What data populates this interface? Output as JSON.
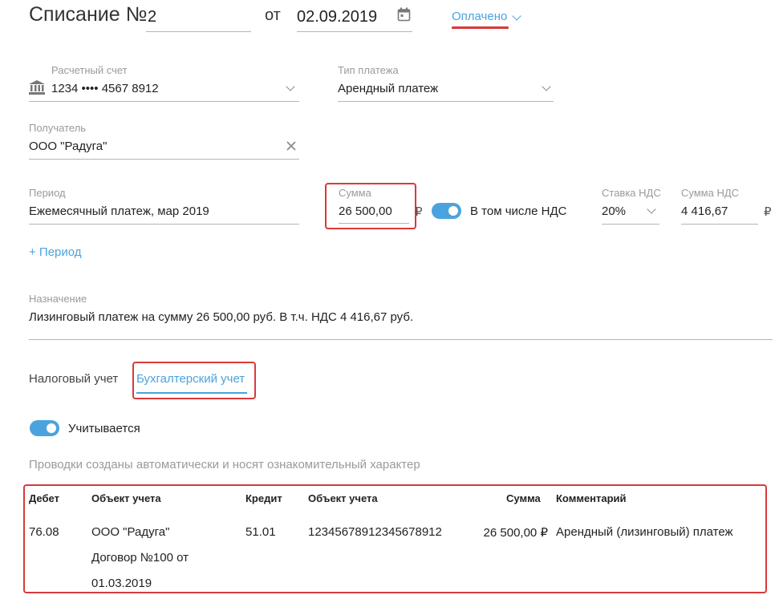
{
  "header": {
    "title": "Списание №",
    "number": "2",
    "date_prefix": "от",
    "date": "02.09.2019",
    "status": "Оплачено"
  },
  "account": {
    "label": "Расчетный счет",
    "value": "1234 •••• 4567 8912"
  },
  "payment_type": {
    "label": "Тип платежа",
    "value": "Арендный платеж"
  },
  "recipient": {
    "label": "Получатель",
    "value": "ООО \"Радуга\""
  },
  "period": {
    "label": "Период",
    "value": "Ежемесячный платеж, мар 2019"
  },
  "amount": {
    "label": "Сумма",
    "value": "26 500,00",
    "currency": "₽"
  },
  "vat_toggle": {
    "label": "В том числе НДС",
    "on": true
  },
  "vat_rate": {
    "label": "Ставка НДС",
    "value": "20%"
  },
  "vat_amount": {
    "label": "Сумма НДС",
    "value": "4 416,67",
    "currency": "₽"
  },
  "add_period": "+ Период",
  "purpose": {
    "label": "Назначение",
    "value": "Лизинговый платеж на сумму 26 500,00 руб. В т.ч. НДС 4 416,67 руб."
  },
  "tabs": [
    {
      "label": "Налоговый учет",
      "active": false
    },
    {
      "label": "Бухгалтерский учет",
      "active": true
    }
  ],
  "accounting_toggle": {
    "label": "Учитывается",
    "on": true
  },
  "note": "Проводки созданы автоматически и носят ознакомительный характер",
  "entries": {
    "headers": [
      "Дебет",
      "Объект учета",
      "Кредит",
      "Объект учета",
      "Сумма",
      "Комментарий"
    ],
    "rows": [
      {
        "debit": "76.08",
        "debit_object_lines": [
          "ООО \"Радуга\"",
          "Договор №100 от",
          "01.03.2019"
        ],
        "credit": "51.01",
        "credit_object": "12345678912345678912",
        "amount": "26 500,00 ₽",
        "comment": "Арендный (лизинговый) платеж"
      }
    ]
  },
  "colors": {
    "accent": "#4aa3df",
    "highlight": "#d9393b",
    "status_underline": "#d9393b"
  }
}
